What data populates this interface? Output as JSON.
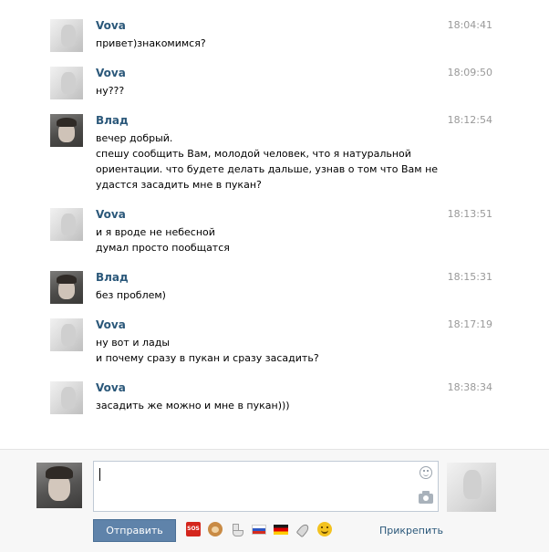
{
  "messages": [
    {
      "author": "Vova",
      "time": "18:04:41",
      "lines": [
        "привет)знакомимся?"
      ]
    },
    {
      "author": "Vova",
      "time": "18:09:50",
      "lines": [
        "ну???"
      ]
    },
    {
      "author": "Влад",
      "time": "18:12:54",
      "lines": [
        "вечер добрый.",
        "спешу сообщить Вам, молодой человек, что я натуральной",
        "ориентации. что будете делать дальше, узнав о том что Вам не",
        "удастся засадить мне в пукан?"
      ]
    },
    {
      "author": "Vova",
      "time": "18:13:51",
      "lines": [
        "и я вроде не небесной",
        "думал просто пообщатся"
      ]
    },
    {
      "author": "Влад",
      "time": "18:15:31",
      "lines": [
        "без проблем)"
      ]
    },
    {
      "author": "Vova",
      "time": "18:17:19",
      "lines": [
        "ну вот и лады",
        "и почему сразу в пукан и сразу засадить?"
      ]
    },
    {
      "author": "Vova",
      "time": "18:38:34",
      "lines": [
        "засадить же можно и мне в пукан)))"
      ]
    }
  ],
  "composer": {
    "input_value": "",
    "send_label": "Отправить",
    "attach_label": "Прикрепить",
    "emoji_icons": [
      "sos-icon",
      "monkey-icon",
      "toilet-icon",
      "russia-flag-icon",
      "germany-flag-icon",
      "rocket-icon",
      "smile-icon"
    ],
    "sos_text": "SOS"
  },
  "colors": {
    "author": "#2b587a",
    "send_button": "#5f83aa",
    "time": "#999999"
  }
}
